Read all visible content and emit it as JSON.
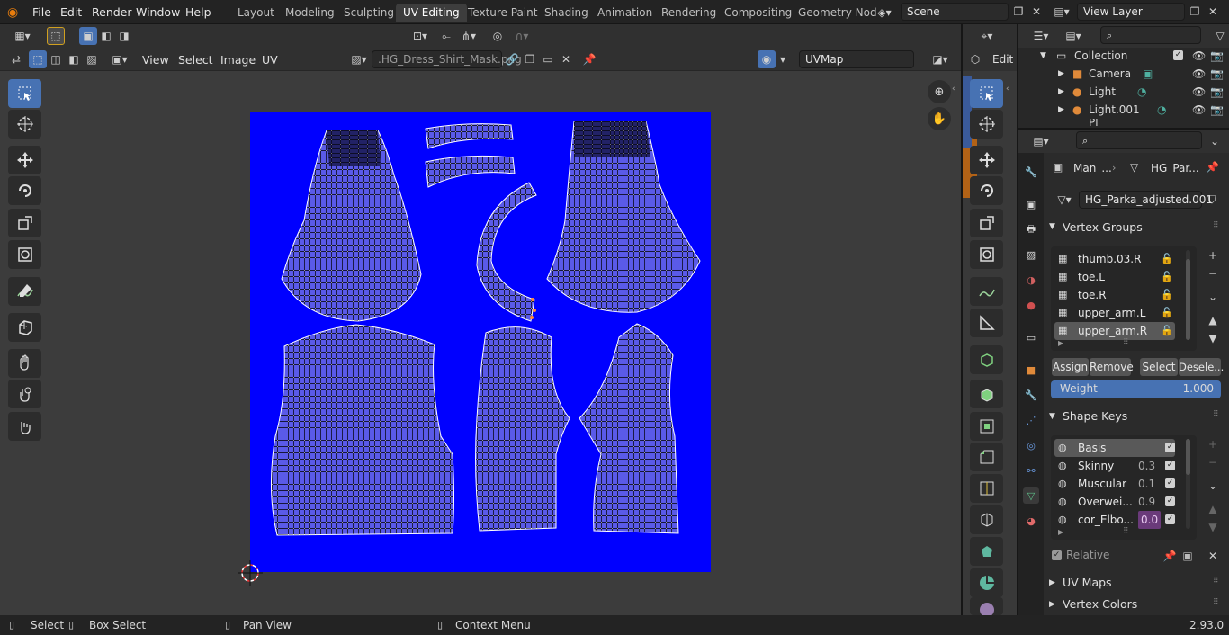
{
  "menubar": {
    "items": [
      "File",
      "Edit",
      "Render",
      "Window",
      "Help"
    ],
    "workspaces": [
      "Layout",
      "Modeling",
      "Sculpting",
      "UV Editing",
      "Texture Paint",
      "Shading",
      "Animation",
      "Rendering",
      "Compositing",
      "Geometry Nod"
    ],
    "active_workspace": "UV Editing",
    "scene": "Scene",
    "view_layer": "View Layer"
  },
  "uv_editor": {
    "menus": [
      "View",
      "Select",
      "Image",
      "UV"
    ],
    "image_name": ".HG_Dress_Shirt_Mask.png",
    "uv_map": "UVMap",
    "texture_color": "#0000ff"
  },
  "viewport_strip": {
    "mode_label": "Edit I"
  },
  "outliner": {
    "collection": "Collection",
    "items": [
      {
        "name": "Camera",
        "type": "camera"
      },
      {
        "name": "Light",
        "type": "light"
      },
      {
        "name": "Light.001",
        "type": "light"
      }
    ],
    "partial_row_label": "Pl"
  },
  "properties": {
    "breadcrumb_object": "Man_...",
    "breadcrumb_mesh": "HG_Par...",
    "mesh_name": "HG_Parka_adjusted.001",
    "vertex_groups_title": "Vertex Groups",
    "vertex_groups": [
      {
        "name": "thumb.03.R",
        "selected": false
      },
      {
        "name": "toe.L",
        "selected": false
      },
      {
        "name": "toe.R",
        "selected": false
      },
      {
        "name": "upper_arm.L",
        "selected": false
      },
      {
        "name": "upper_arm.R",
        "selected": true
      }
    ],
    "buttons": {
      "assign": "Assign",
      "remove": "Remove",
      "select": "Select",
      "deselect": "Desele..."
    },
    "weight_label": "Weight",
    "weight_value": "1.000",
    "shape_keys_title": "Shape Keys",
    "shape_keys": [
      {
        "name": "Basis",
        "value": "",
        "selected": true
      },
      {
        "name": "Skinny",
        "value": "0.3",
        "selected": false
      },
      {
        "name": "Muscular",
        "value": "0.1",
        "selected": false
      },
      {
        "name": "Overwei...",
        "value": "0.9",
        "selected": false
      },
      {
        "name": "cor_Elbo...",
        "value": "0.0",
        "selected": false,
        "driven": true
      }
    ],
    "relative_label": "Relative",
    "uv_maps_title": "UV Maps",
    "vertex_colors_title": "Vertex Colors",
    "accent_color": "#4772b3"
  },
  "statusbar": {
    "select": "Select",
    "box_select": "Box Select",
    "pan_view": "Pan View",
    "context_menu": "Context Menu",
    "version": "2.93.0"
  }
}
